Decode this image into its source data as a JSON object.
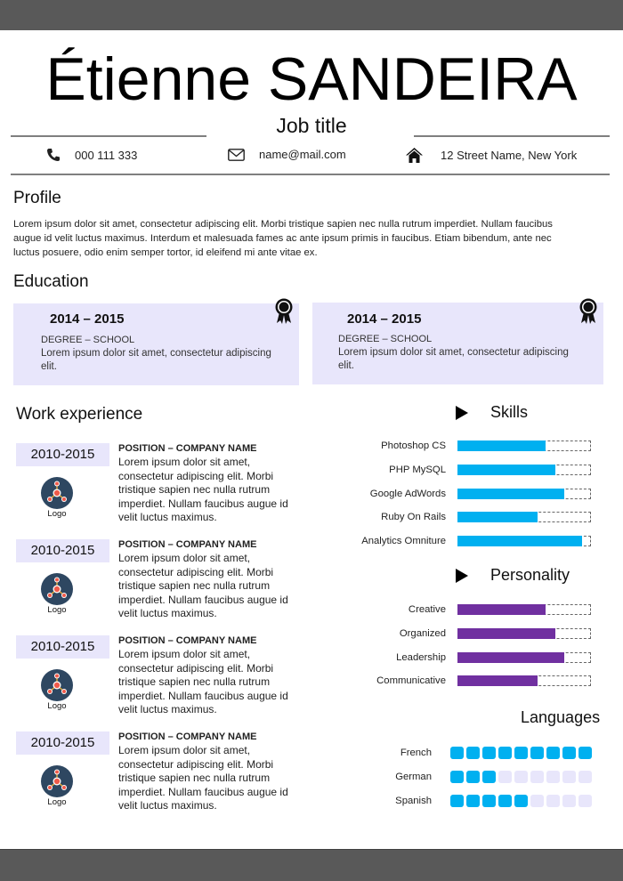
{
  "header": {
    "name": "Étienne SANDEIRA",
    "job_title": "Job title",
    "contact": {
      "phone": "000 111 333",
      "email": "name@mail.com",
      "address": "12 Street Name, New York"
    }
  },
  "profile": {
    "title": "Profile",
    "lines": [
      "Lorem ipsum dolor sit amet, consectetur adipiscing elit. Morbi tristique sapien nec nulla rutrum imperdiet. Nullam faucibus",
      "augue id velit luctus maximus. Interdum et malesuada fames ac ante ipsum primis in faucibus. Etiam bibendum, ante nec",
      "luctus posuere, odio enim semper tortor, id eleifend mi ante vitae ex."
    ]
  },
  "education": {
    "title": "Education",
    "items": [
      {
        "years": "2014 – 2015",
        "degree": "DEGREE – SCHOOL",
        "desc_line1": "Lorem ipsum dolor sit amet, consectetur adipiscing",
        "desc_line2": "elit."
      },
      {
        "years": "2014 – 2015",
        "degree": "DEGREE – SCHOOL",
        "desc_line1": "Lorem ipsum dolor sit amet, consectetur adipiscing",
        "desc_line2": "elit."
      }
    ]
  },
  "work": {
    "title": "Work experience",
    "items": [
      {
        "years": "2010-2015",
        "logo_label": "Logo",
        "position": "POSITION – COMPANY NAME",
        "lines": [
          "Lorem ipsum dolor sit amet,",
          "consectetur adipiscing elit. Morbi",
          "tristique sapien nec nulla rutrum",
          "imperdiet. Nullam faucibus augue id",
          "velit luctus maximus."
        ]
      },
      {
        "years": "2010-2015",
        "logo_label": "Logo",
        "position": "POSITION – COMPANY NAME",
        "lines": [
          "Lorem ipsum dolor sit amet,",
          "consectetur adipiscing elit. Morbi",
          "tristique sapien nec nulla rutrum",
          "imperdiet. Nullam faucibus augue id",
          "velit luctus maximus."
        ]
      },
      {
        "years": "2010-2015",
        "logo_label": "Logo",
        "position": "POSITION – COMPANY NAME",
        "lines": [
          "Lorem ipsum dolor sit amet,",
          "consectetur adipiscing elit. Morbi",
          "tristique sapien nec nulla rutrum",
          "imperdiet. Nullam faucibus augue id",
          "velit luctus maximus."
        ]
      },
      {
        "years": "2010-2015",
        "logo_label": "Logo",
        "position": "POSITION – COMPANY NAME",
        "lines": [
          "Lorem ipsum dolor sit amet,",
          "consectetur adipiscing elit. Morbi",
          "tristique sapien nec nulla rutrum",
          "imperdiet. Nullam faucibus augue id",
          "velit luctus maximus."
        ]
      }
    ]
  },
  "skills": {
    "title": "Skills",
    "color": "#00b0f0",
    "items": [
      {
        "label": "Photoshop CS",
        "level": 0.66
      },
      {
        "label": "PHP MySQL",
        "level": 0.73
      },
      {
        "label": "Google AdWords",
        "level": 0.8
      },
      {
        "label": "Ruby On Rails",
        "level": 0.6
      },
      {
        "label": "Analytics Omniture",
        "level": 0.93
      }
    ]
  },
  "personality": {
    "title": "Personality",
    "color": "#7030a0",
    "items": [
      {
        "label": "Creative",
        "level": 0.66
      },
      {
        "label": "Organized",
        "level": 0.73
      },
      {
        "label": "Leadership",
        "level": 0.8
      },
      {
        "label": "Communicative",
        "level": 0.6
      }
    ]
  },
  "languages": {
    "title": "Languages",
    "max": 9,
    "filled_color": "#00b0f0",
    "empty_color": "#e8e6fb",
    "items": [
      {
        "label": "French",
        "level": 9
      },
      {
        "label": "German",
        "level": 3
      },
      {
        "label": "Spanish",
        "level": 5
      }
    ]
  },
  "colors": {
    "bar_gray": "#595959",
    "card_bg": "#e8e6fb",
    "logo_bg": "#2e4761",
    "logo_accent": "#f05a4a"
  }
}
